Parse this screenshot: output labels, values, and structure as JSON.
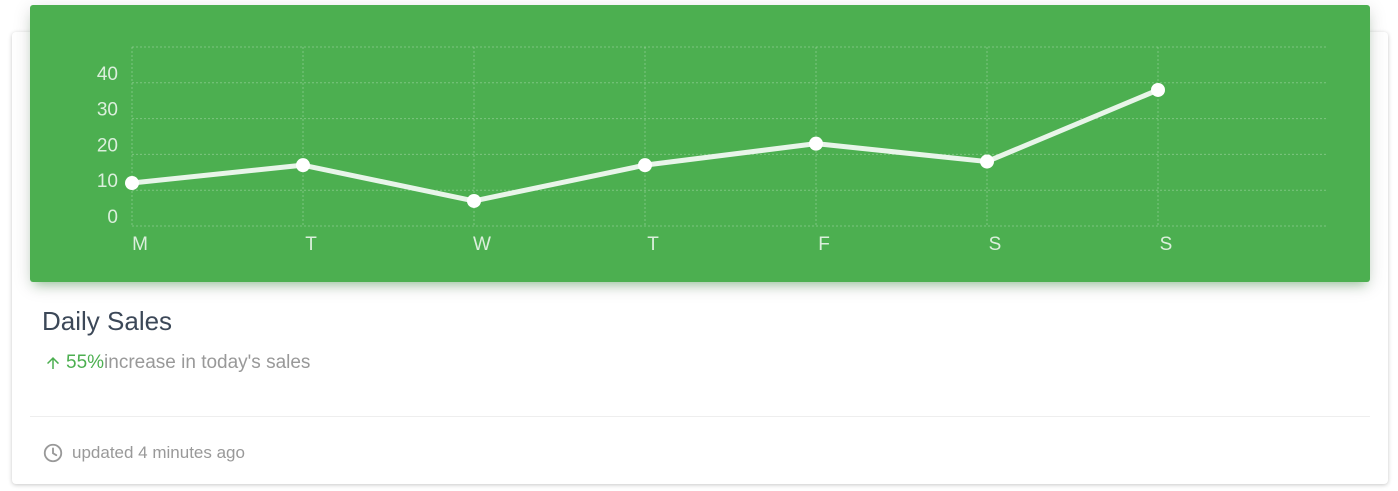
{
  "card": {
    "title": "Daily Sales",
    "category": {
      "percent": "55%",
      "suffix": "increase in today's sales",
      "arrow_icon": "arrow-upward-icon"
    },
    "footer": {
      "icon": "access-time-icon",
      "text": "updated 4 minutes ago"
    }
  },
  "colors": {
    "header_background": "#4caf50",
    "accent_green": "#4caf50",
    "title_text": "#3c4858",
    "muted_text": "#999999",
    "line": "#e8f5e9"
  },
  "chart_data": {
    "type": "line",
    "categories": [
      "M",
      "T",
      "W",
      "T",
      "F",
      "S",
      "S"
    ],
    "series": [
      {
        "values": [
          12,
          17,
          7,
          17,
          23,
          18,
          38
        ]
      }
    ],
    "ylim": [
      0,
      50
    ],
    "yticks": [
      0,
      10,
      20,
      30,
      40
    ],
    "grid": true,
    "title": "",
    "xlabel": "",
    "ylabel": ""
  }
}
